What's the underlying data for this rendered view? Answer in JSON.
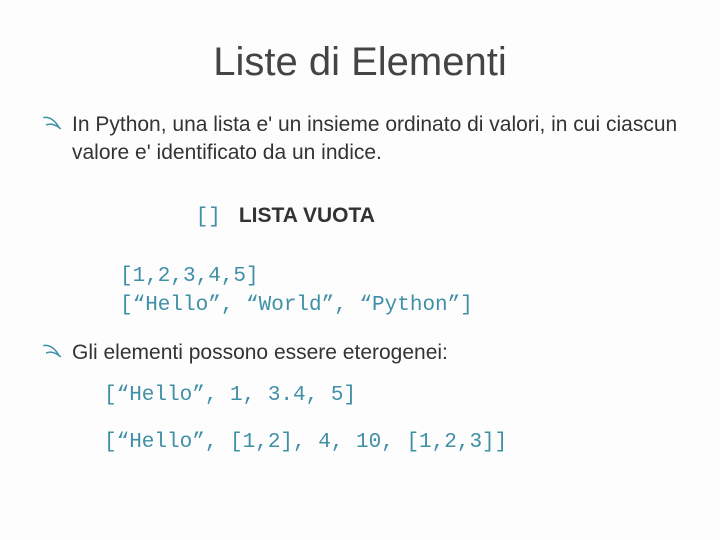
{
  "title": "Liste di Elementi",
  "bullets": {
    "b1": "In Python, una lista e' un insieme ordinato di valori, in cui ciascun valore e' identificato da un indice.",
    "b2": "Gli elementi possono essere eterogenei:"
  },
  "code1": {
    "l1_code": "[]",
    "l1_label": "LISTA VUOTA",
    "l2": "[1,2,3,4,5]",
    "l3": "[“Hello”, “World”, “Python”]"
  },
  "code2": {
    "l1": "[“Hello”, 1, 3.4, 5]"
  },
  "code3": {
    "l1": "[“Hello”, [1,2], 4, 10, [1,2,3]]"
  }
}
